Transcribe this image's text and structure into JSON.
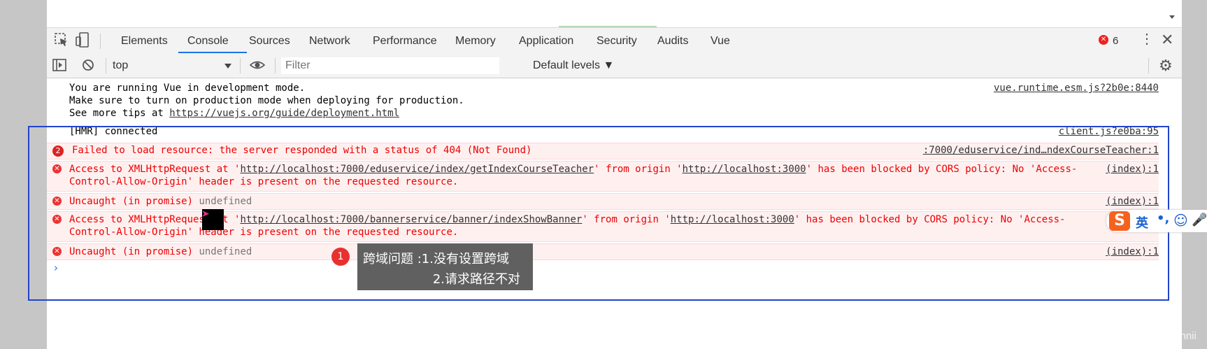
{
  "devtools": {
    "tabs": [
      "Elements",
      "Console",
      "Sources",
      "Network",
      "Performance",
      "Memory",
      "Application",
      "Security",
      "Audits",
      "Vue"
    ],
    "active_tab": "Console",
    "error_count": "6"
  },
  "toolbar": {
    "context": "top",
    "filter_placeholder": "Filter",
    "levels": "Default levels ▼"
  },
  "console": {
    "vue_line1": "You are running Vue in development mode.",
    "vue_line2": "Make sure to turn on production mode when deploying for production.",
    "vue_line3_prefix": "See more tips at ",
    "vue_line3_link": "https://vuejs.org/guide/deployment.html",
    "vue_src": "vue.runtime.esm.js?2b0e:8440",
    "hmr": "[HMR] connected",
    "hmr_src": "client.js?e0ba:95",
    "fail_count": "2",
    "fail_msg": "Failed to load resource: the server responded with a status of 404 (Not Found)",
    "fail_src": ":7000/eduservice/ind…ndexCourseTeacher:1",
    "cors1_a": "Access to XMLHttpRequest at '",
    "cors1_url": "http://localhost:7000/eduservice/index/getIndexCourseTeacher",
    "cors1_b": "' from origin '",
    "cors1_origin": "http://localhost:3000",
    "cors1_c": "' has been blocked by CORS policy: No 'Access-",
    "cors1_d": "Control-Allow-Origin' header is present on the requested resource.",
    "index_src": "(index):1",
    "uncaught": "Uncaught (in promise)",
    "undefined": "undefined",
    "cors2_a": "Access to XMLHttpRequest at '",
    "cors2_url": "http://localhost:7000/bannerservice/banner/indexShowBanner",
    "cors2_b": "' from origin '",
    "cors2_origin": "http://localhost:3000",
    "cors2_c": "' has been blocked by CORS policy: No 'Access-",
    "cors2_d": "Control-Allow-Origin' header is present on the requested resource."
  },
  "annotation": {
    "number": "1",
    "line1": "跨域问题 :1.没有设置跨域",
    "line2": "2.请求路径不对"
  },
  "ime": {
    "logo": "S",
    "lang": "英",
    "punct": "•,"
  },
  "watermark": "https://blog.csdn.net/nnnnnnnnnnnii"
}
